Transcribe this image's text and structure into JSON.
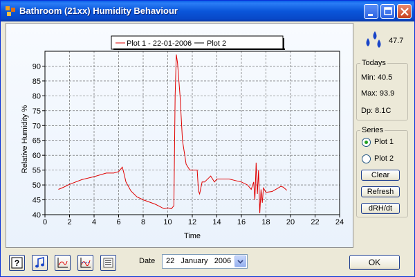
{
  "window": {
    "title": "Bathroom (21xx) Humidity Behaviour"
  },
  "legend": {
    "plot1": "Plot 1 - 22-01-2006",
    "plot2": "Plot 2"
  },
  "humidity": {
    "current": "47.7"
  },
  "todays": {
    "title": "Todays",
    "min": "Min: 40.5",
    "max": "Max: 93.9",
    "dp": "Dp: 8.1C"
  },
  "series": {
    "title": "Series",
    "options": [
      {
        "label": "Plot 1",
        "selected": true
      },
      {
        "label": "Plot 2",
        "selected": false
      }
    ],
    "clear_label": "Clear",
    "refresh_label": "Refresh",
    "drh_label": "dRH/dt"
  },
  "toolbar": {
    "icons": [
      "help-icon",
      "music-note-icon",
      "chart-icon",
      "chart-alt-icon",
      "list-icon"
    ]
  },
  "date": {
    "label": "Date",
    "value": "22   January   2006"
  },
  "ok_label": "OK",
  "colors": {
    "plot1": "#e00000",
    "grid": "#555555",
    "accent": "#0a56da"
  },
  "chart_data": {
    "type": "line",
    "xlabel": "Time",
    "ylabel": "Relative Humidity %",
    "xlim": [
      0,
      24
    ],
    "ylim": [
      40,
      95
    ],
    "x_ticks": [
      0,
      2,
      4,
      6,
      8,
      10,
      12,
      14,
      16,
      18,
      20,
      22,
      24
    ],
    "y_ticks": [
      40,
      45,
      50,
      55,
      60,
      65,
      70,
      75,
      80,
      85,
      90
    ],
    "grid": true,
    "legend_position": "top-center",
    "series": [
      {
        "name": "Plot 1 - 22-01-2006",
        "x": [
          1.1,
          1.5,
          2.0,
          3.0,
          4.0,
          5.0,
          5.6,
          6.0,
          6.2,
          6.3,
          6.4,
          6.6,
          7.0,
          7.5,
          8.0,
          9.0,
          9.7,
          10.0,
          10.3,
          10.5,
          10.6,
          10.7,
          10.8,
          11.0,
          11.2,
          11.5,
          11.8,
          12.0,
          12.2,
          12.4,
          12.5,
          12.6,
          12.8,
          13.0,
          13.5,
          13.8,
          14.0,
          14.5,
          15.0,
          15.5,
          16.0,
          16.5,
          16.8,
          17.0,
          17.1,
          17.2,
          17.3,
          17.4,
          17.5,
          17.6,
          17.7,
          17.8,
          18.0,
          18.5,
          19.0,
          19.2,
          19.4,
          19.7
        ],
        "y": [
          48.5,
          49.2,
          50.2,
          51.8,
          52.8,
          54.0,
          54.0,
          54.5,
          55.5,
          56.0,
          54.5,
          51.0,
          48.0,
          46.0,
          45.0,
          43.5,
          42.0,
          42.3,
          42.0,
          43.0,
          80.0,
          93.9,
          91.0,
          80.0,
          65.0,
          57.0,
          55.0,
          55.0,
          55.0,
          55.0,
          48.0,
          47.0,
          51.0,
          51.0,
          53.0,
          51.0,
          52.0,
          52.0,
          52.0,
          51.5,
          51.0,
          50.0,
          48.5,
          51.0,
          45.0,
          57.5,
          47.0,
          55.0,
          40.5,
          48.5,
          44.0,
          49.0,
          47.5,
          47.8,
          49.0,
          49.5,
          49.3,
          48.2
        ]
      },
      {
        "name": "Plot 2",
        "x": [],
        "y": []
      }
    ]
  }
}
